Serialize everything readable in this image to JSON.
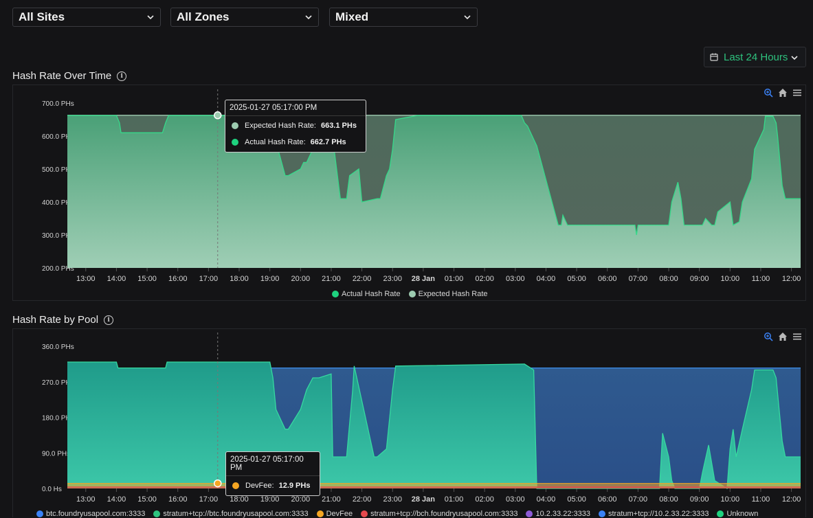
{
  "filters": {
    "site": "All Sites",
    "zone": "All Zones",
    "mode": "Mixed",
    "time_range": "Last 24 Hours"
  },
  "colors": {
    "accent": "#2ec27e",
    "actual": "#1ed27f",
    "expected": "#9dcbb0",
    "toolbar_blue": "#3b82f6"
  },
  "chart1": {
    "title": "Hash Rate Over Time",
    "tooltip": {
      "time": "2025-01-27 05:17:00 PM",
      "rows": [
        {
          "label": "Expected Hash Rate:",
          "value": "663.1 PHs",
          "color": "#9dcbb0"
        },
        {
          "label": "Actual Hash Rate:",
          "value": "662.7 PHs",
          "color": "#1ed27f"
        }
      ]
    },
    "legend": [
      {
        "label": "Actual Hash Rate",
        "color": "#1ed27f"
      },
      {
        "label": "Expected Hash Rate",
        "color": "#9dcbb0"
      }
    ]
  },
  "chart2": {
    "title": "Hash Rate by Pool",
    "tooltip": {
      "time": "2025-01-27 05:17:00 PM",
      "rows": [
        {
          "label": "DevFee:",
          "value": "12.9 PHs",
          "color": "#f5a623"
        }
      ]
    },
    "legend": [
      {
        "label": "btc.foundryusapool.com:3333",
        "color": "#3b82f6"
      },
      {
        "label": "stratum+tcp://btc.foundryusapool.com:3333",
        "color": "#2ec27e"
      },
      {
        "label": "DevFee",
        "color": "#f5a623"
      },
      {
        "label": "stratum+tcp://bch.foundryusapool.com:3333",
        "color": "#e5484d"
      },
      {
        "label": "10.2.33.22:3333",
        "color": "#8e5bd6"
      },
      {
        "label": "stratum+tcp://10.2.33.22:3333",
        "color": "#3b82f6"
      },
      {
        "label": "Unknown",
        "color": "#1ed27f"
      }
    ]
  },
  "chart_data": [
    {
      "type": "area",
      "title": "Hash Rate Over Time",
      "ylabel": "",
      "y_tick_labels": [
        "700.0 PHs",
        "600.0 PHs",
        "500.0 PHs",
        "400.0 PHs",
        "300.0 PHs",
        "200.0 PHs"
      ],
      "y_ticks": [
        700,
        600,
        500,
        400,
        300,
        200
      ],
      "ylim": [
        200,
        700
      ],
      "x_tick_labels": [
        "13:00",
        "14:00",
        "15:00",
        "16:00",
        "17:00",
        "18:00",
        "19:00",
        "20:00",
        "21:00",
        "22:00",
        "23:00",
        "28 Jan",
        "01:00",
        "02:00",
        "03:00",
        "04:00",
        "05:00",
        "06:00",
        "07:00",
        "08:00",
        "09:00",
        "10:00",
        "11:00",
        "12:00"
      ],
      "xlim": [
        12.4,
        36.3
      ],
      "series": [
        {
          "name": "Expected Hash Rate",
          "x": [
            12.4,
            36.3
          ],
          "values": [
            663,
            663
          ]
        },
        {
          "name": "Actual Hash Rate",
          "x": [
            12.4,
            14.0,
            14.1,
            14.15,
            15.5,
            15.6,
            15.7,
            17.3,
            19.0,
            19.1,
            19.15,
            19.5,
            19.6,
            20.0,
            20.1,
            20.2,
            20.4,
            20.5,
            20.6,
            21.0,
            21.3,
            21.5,
            21.6,
            21.9,
            22.0,
            22.5,
            22.6,
            22.8,
            22.9,
            23.0,
            23.1,
            23.8,
            27.2,
            27.3,
            27.4,
            27.6,
            27.7,
            28.4,
            28.5,
            28.55,
            28.7,
            30.9,
            30.95,
            31.0,
            32.0,
            32.1,
            32.3,
            32.4,
            32.5,
            33.1,
            33.2,
            33.4,
            33.5,
            33.6,
            34.0,
            34.1,
            34.3,
            34.4,
            34.7,
            34.8,
            35.1,
            35.15,
            35.4,
            35.5,
            35.55,
            35.7,
            35.8,
            36.3
          ],
          "values": [
            662,
            662,
            640,
            610,
            610,
            640,
            662,
            662,
            662,
            640,
            600,
            480,
            480,
            500,
            520,
            520,
            560,
            600,
            620,
            630,
            410,
            410,
            480,
            500,
            400,
            410,
            410,
            480,
            500,
            560,
            650,
            662,
            662,
            640,
            630,
            590,
            570,
            330,
            330,
            360,
            330,
            330,
            300,
            330,
            330,
            400,
            460,
            410,
            330,
            330,
            350,
            330,
            330,
            370,
            400,
            330,
            340,
            400,
            470,
            560,
            620,
            660,
            660,
            640,
            600,
            450,
            410,
            410
          ]
        }
      ]
    },
    {
      "type": "area",
      "title": "Hash Rate by Pool",
      "ylabel": "",
      "y_tick_labels": [
        "360.0 PHs",
        "270.0 PHs",
        "180.0 PHs",
        "90.0 PHs",
        "0.0 Hs"
      ],
      "y_ticks": [
        360,
        270,
        180,
        90,
        0
      ],
      "ylim": [
        0,
        360
      ],
      "x_tick_labels": [
        "13:00",
        "14:00",
        "15:00",
        "16:00",
        "17:00",
        "18:00",
        "19:00",
        "20:00",
        "21:00",
        "22:00",
        "23:00",
        "28 Jan",
        "01:00",
        "02:00",
        "03:00",
        "04:00",
        "05:00",
        "06:00",
        "07:00",
        "08:00",
        "09:00",
        "10:00",
        "11:00",
        "12:00"
      ],
      "xlim": [
        12.4,
        36.3
      ],
      "series": [
        {
          "name": "btc.foundryusapool.com:3333",
          "x": [
            12.4,
            36.3
          ],
          "values": [
            305,
            305
          ]
        },
        {
          "name": "stratum+tcp://btc.foundryusapool.com:3333",
          "x": [
            12.4,
            14.0,
            14.05,
            15.6,
            15.65,
            17.3,
            19.0,
            19.1,
            19.2,
            19.5,
            19.6,
            20.0,
            20.2,
            20.4,
            20.6,
            21.0,
            21.05,
            21.5,
            21.7,
            21.75,
            22.4,
            22.5,
            22.8,
            23.0,
            23.1,
            27.3,
            27.4,
            27.6,
            27.7,
            30.7,
            31.7,
            31.8,
            32.0,
            32.1,
            32.2,
            33.0,
            33.1,
            33.3,
            33.5,
            33.9,
            34.0,
            34.1,
            34.2,
            34.4,
            34.7,
            34.8,
            35.4,
            35.5,
            35.7,
            35.8,
            36.3
          ],
          "values": [
            320,
            320,
            305,
            305,
            320,
            320,
            320,
            280,
            200,
            150,
            150,
            200,
            250,
            280,
            280,
            290,
            80,
            80,
            250,
            310,
            80,
            80,
            100,
            250,
            310,
            315,
            310,
            300,
            0,
            0,
            0,
            140,
            80,
            20,
            0,
            0,
            40,
            110,
            20,
            0,
            100,
            150,
            80,
            150,
            250,
            300,
            300,
            280,
            120,
            80,
            80
          ]
        },
        {
          "name": "DevFee",
          "x": [
            12.4,
            36.3
          ],
          "values": [
            12.9,
            12.9
          ]
        },
        {
          "name": "stratum+tcp://bch.foundryusapool.com:3333",
          "x": [
            12.4,
            36.3
          ],
          "values": [
            4,
            4
          ]
        },
        {
          "name": "10.2.33.22:3333",
          "x": [
            12.4,
            36.3
          ],
          "values": [
            0,
            0
          ]
        },
        {
          "name": "stratum+tcp://10.2.33.22:3333",
          "x": [
            12.4,
            36.3
          ],
          "values": [
            0,
            0
          ]
        },
        {
          "name": "Unknown",
          "x": [
            12.4,
            36.3
          ],
          "values": [
            0,
            0
          ]
        }
      ]
    }
  ]
}
